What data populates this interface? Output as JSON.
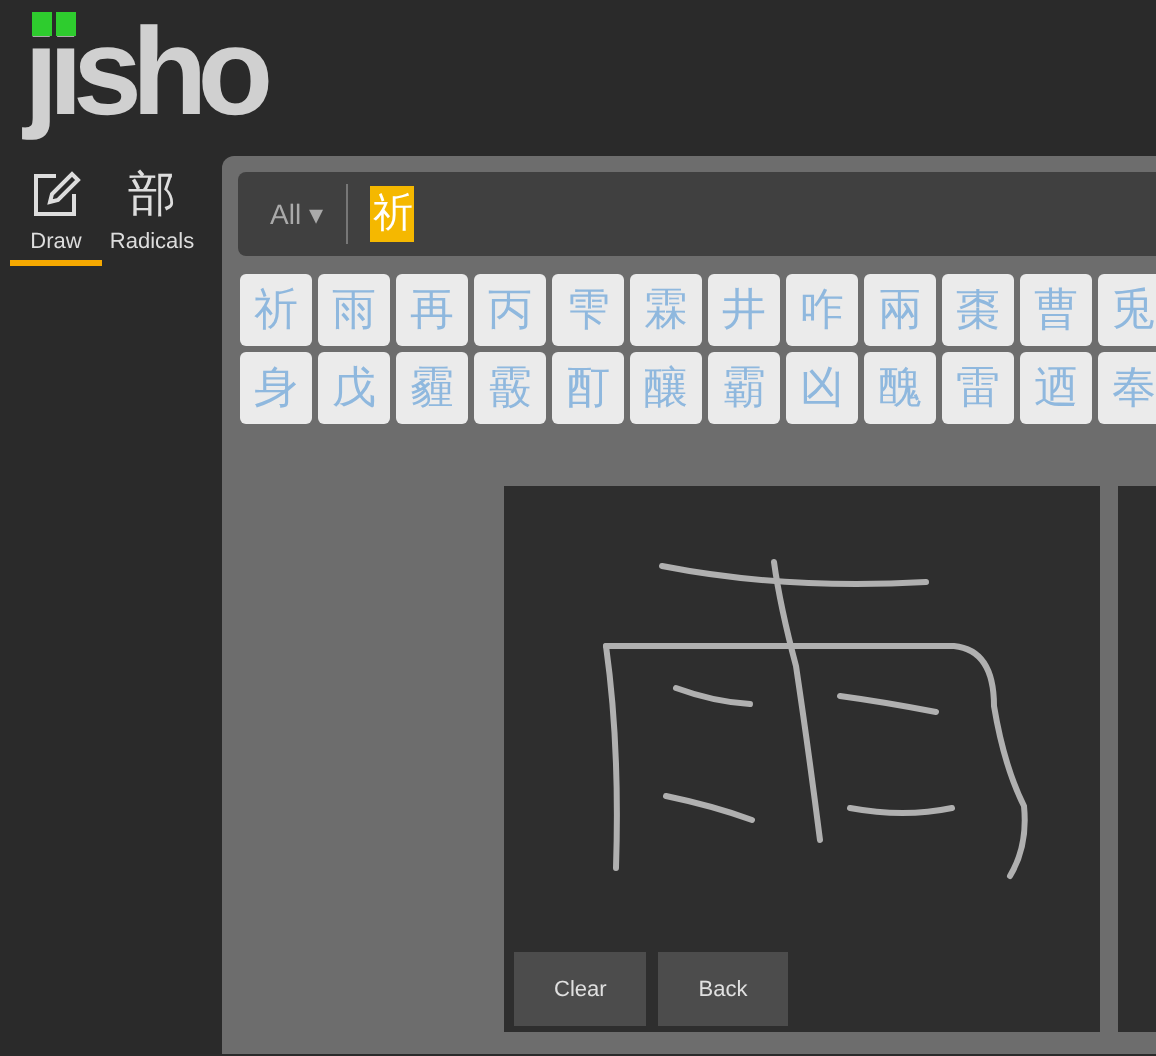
{
  "logo": {
    "text": "jisho"
  },
  "nav_tabs": [
    {
      "label": "Draw",
      "kind": "draw",
      "selected": true
    },
    {
      "label": "Radicals",
      "kind": "radicals",
      "icon_text": "部",
      "selected": false
    }
  ],
  "search": {
    "filter": "All ▾",
    "value": "祈"
  },
  "candidates": [
    "祈",
    "雨",
    "再",
    "丙",
    "雫",
    "霖",
    "井",
    "咋",
    "兩",
    "棗",
    "曹",
    "兎",
    "身",
    "戊",
    "霾",
    "霰",
    "酊",
    "釀",
    "霸",
    "凶",
    "醜",
    "雷",
    "迺",
    "奉"
  ],
  "canvas": {
    "buttons": [
      "Clear",
      "Back"
    ]
  }
}
